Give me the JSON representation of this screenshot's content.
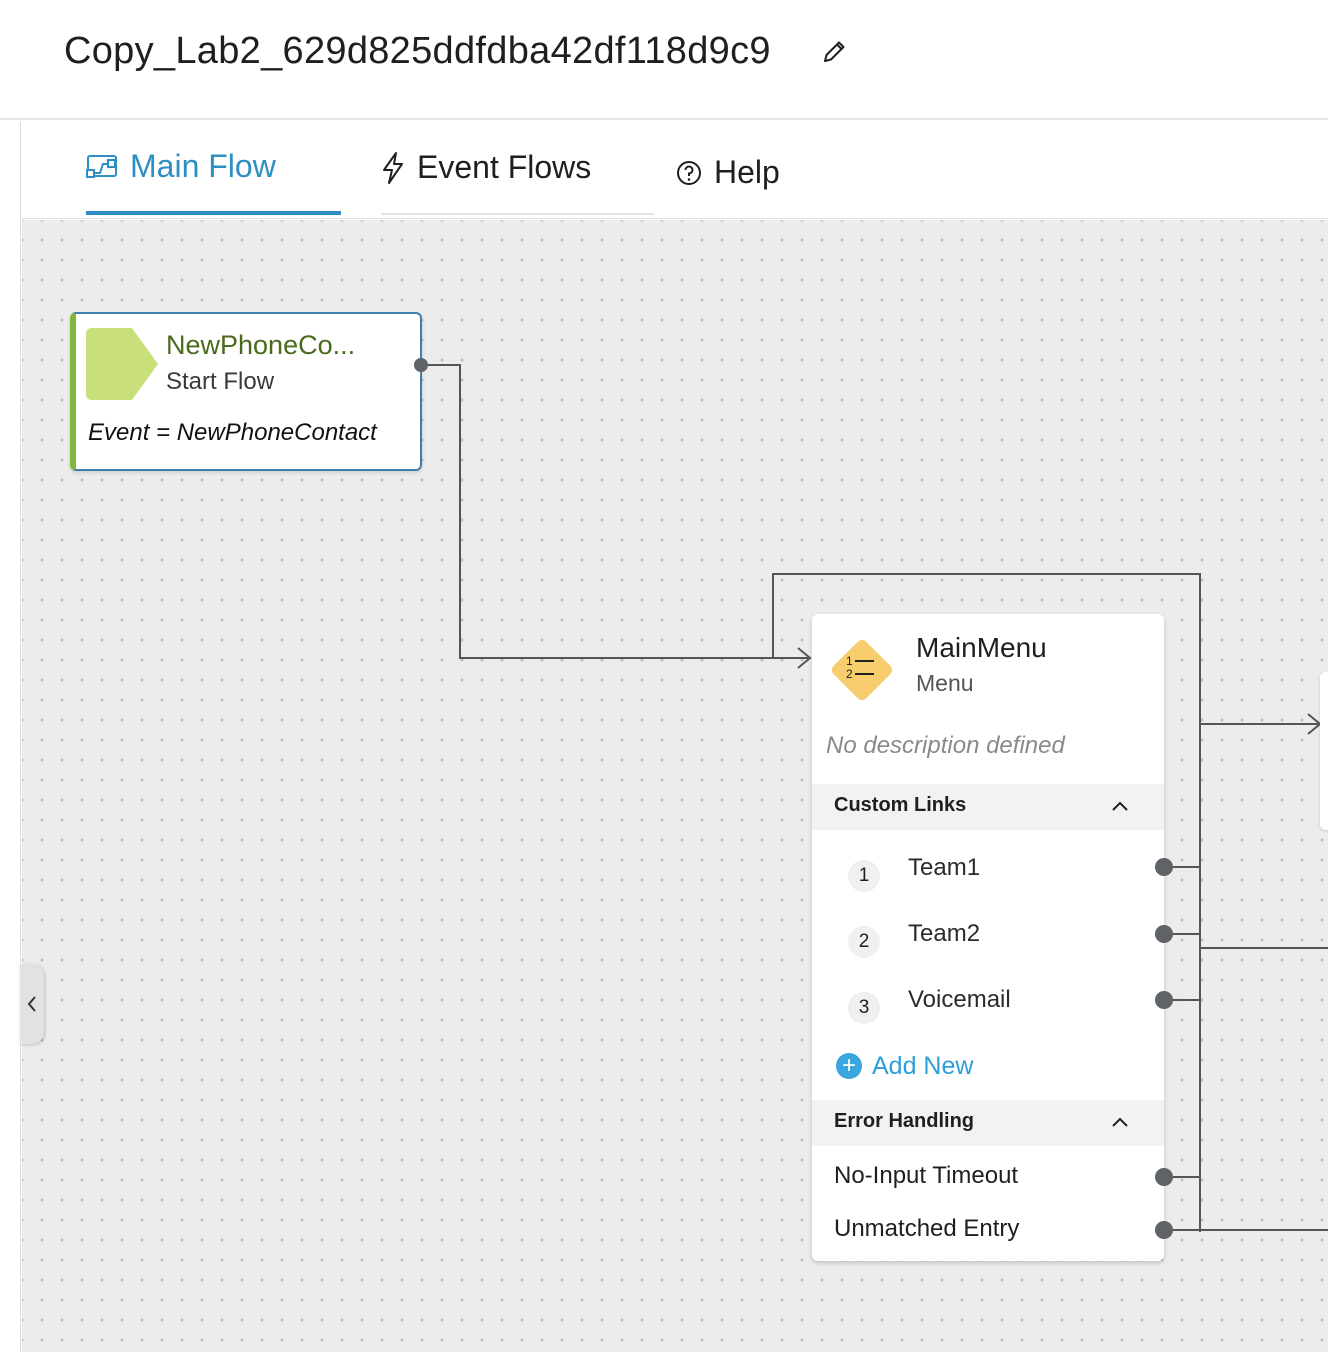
{
  "header": {
    "title": "Copy_Lab2_629d825ddfdba42df118d9c9",
    "edit_icon": "pencil-icon"
  },
  "tabs": [
    {
      "label": "Main Flow",
      "icon": "flow-diagram-icon",
      "active": true
    },
    {
      "label": "Event Flows",
      "icon": "lightning-icon",
      "active": false
    },
    {
      "label": "Help",
      "icon": "question-circle-icon",
      "active": false
    }
  ],
  "start_node": {
    "name": "NewPhoneCo...",
    "type": "Start Flow",
    "event": "Event = NewPhoneContact",
    "color": "#c9e07a"
  },
  "menu_node": {
    "name": "MainMenu",
    "type": "Menu",
    "description": "No description defined",
    "icon_color": "#f7cd6e",
    "custom_links": {
      "title": "Custom Links",
      "items": [
        {
          "num": "1",
          "label": "Team1"
        },
        {
          "num": "2",
          "label": "Team2"
        },
        {
          "num": "3",
          "label": "Voicemail"
        }
      ],
      "add_label": "Add New"
    },
    "error_handling": {
      "title": "Error Handling",
      "items": [
        "No-Input Timeout",
        "Unmatched Entry"
      ]
    }
  },
  "colors": {
    "accent": "#2d8fc4",
    "wire": "#555555",
    "canvas": "#ececec"
  }
}
